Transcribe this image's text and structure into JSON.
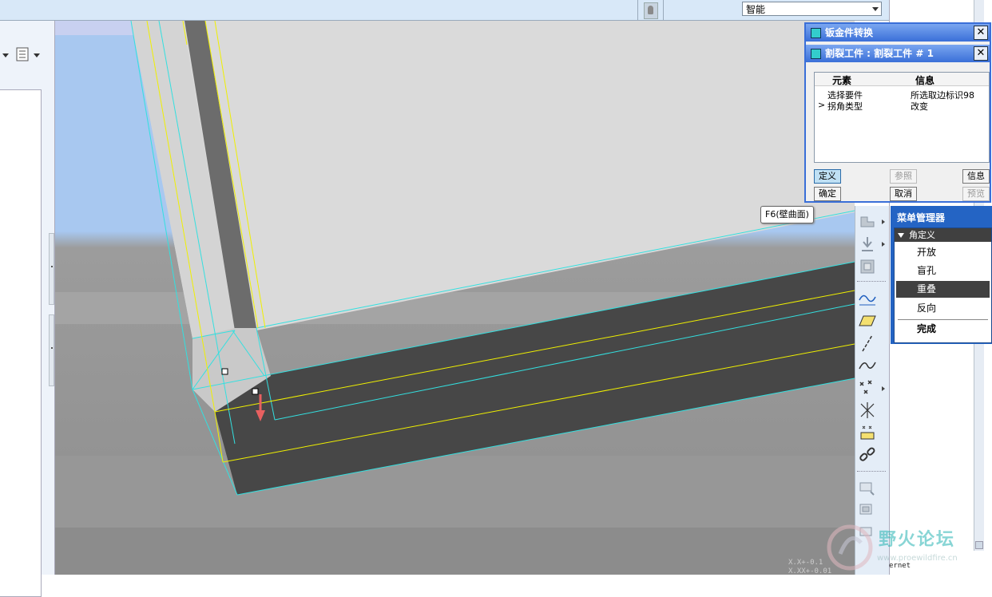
{
  "toolbar": {
    "filter_value": "智能",
    "bulb_icon": "light-bulb-icon"
  },
  "viewport": {
    "coords_line1": "X.X+-0.1",
    "coords_line2": "X.XX+-0.01",
    "drag_handle_color": "#e86060",
    "edge_color": "#33e0e0",
    "yellow_edge_color": "#f0f000"
  },
  "tooltip": {
    "text": "F6(壁曲面)"
  },
  "dialog": {
    "title_main": "钣金件转换",
    "title_sub": "割裂工件 : 割裂工件 # 1",
    "columns": [
      "元素",
      "信息"
    ],
    "rows": [
      {
        "expander": "",
        "element": "选择要件",
        "info": "所选取边标识98"
      },
      {
        "expander": ">",
        "element": "拐角类型",
        "info": "改变"
      }
    ],
    "buttons": {
      "define": "定义",
      "refs": "参照",
      "info": "信息",
      "ok": "确定",
      "cancel": "取消",
      "preview": "预览"
    }
  },
  "menu_manager": {
    "title": "菜单管理器",
    "submenu": "角定义",
    "items": [
      "开放",
      "盲孔",
      "重叠",
      "反向"
    ],
    "selected": "重叠",
    "done": "完成"
  },
  "status": {
    "text": "ernet"
  },
  "watermark": {
    "text": "野火论坛",
    "url": "www.proewildfire.cn"
  }
}
